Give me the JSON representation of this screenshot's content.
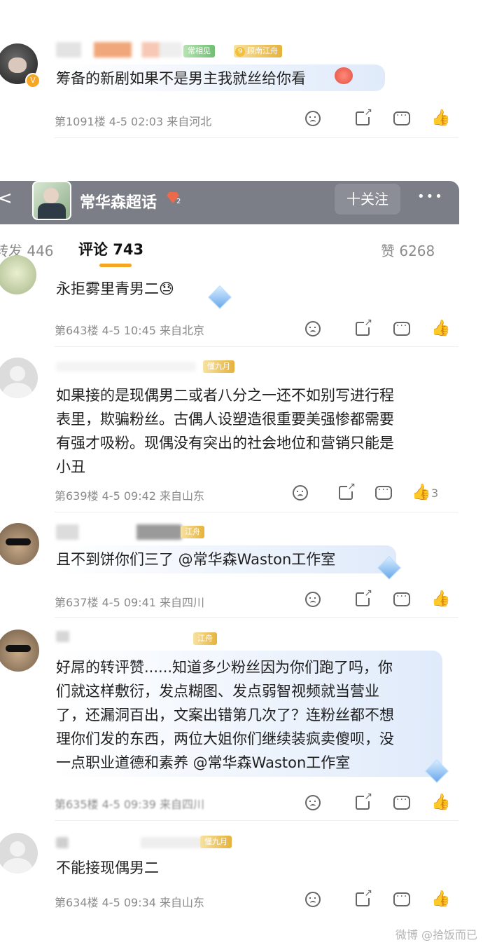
{
  "comments_top": {
    "tags": [
      "常相见",
      "顾南江舟"
    ],
    "level_num": "9",
    "text": "筹备的新剧如果不是男主我就丝给你看",
    "meta": "第1091楼 4-5 02:03 来自河北"
  },
  "header": {
    "title": "常华森超话",
    "follow_label": "十关注",
    "more_label": "•••",
    "back_label": "<",
    "badge_text": "2",
    "tab_repost": "转发 446",
    "tab_comment": "评论 743",
    "tab_like": "赞 6268"
  },
  "comments": [
    {
      "lines": [
        "永拒雾里青男二😓"
      ],
      "meta": "第643楼 4-5 10:45 来自北京",
      "like_count": ""
    },
    {
      "tag": "懂九月",
      "lines": [
        "如果接的是现偶男二或者八分之一还不如别写进行程",
        "表里，欺骗粉丝。古偶人设塑造很重要美强惨都需要",
        "有强才吸粉。现偶没有突出的社会地位和营销只能是",
        "小丑"
      ],
      "meta": "第639楼 4-5 09:42 来自山东",
      "like_count": "3"
    },
    {
      "tag": "江舟",
      "lines": [
        "且不到饼你们三了 @常华森Waston工作室"
      ],
      "meta": "第637楼 4-5 09:41 来自四川",
      "like_count": ""
    },
    {
      "tag": "江舟",
      "lines": [
        "好屌的转评赞......知道多少粉丝因为你们跑了吗，你",
        "们就这样敷衍，发点糊图、发点弱智视频就当营业",
        "了，还漏洞百出，文案出错第几次了？连粉丝都不想",
        "理你们发的东西，两位大姐你们继续装疯卖傻呗，没",
        "一点职业道德和素养 @常华森Waston工作室"
      ],
      "meta": "第635楼 4-5 09:39 来自四川",
      "like_count": ""
    },
    {
      "tag": "懂九月",
      "lines": [
        "不能接现偶男二"
      ],
      "meta": "第634楼 4-5 09:34 来自山东",
      "like_count": ""
    }
  ],
  "watermark": "微博 @拾饭而已",
  "colors": {
    "accent": "#f5a623",
    "header_bg": "#7b7e86",
    "meta": "#8a8a8a"
  }
}
